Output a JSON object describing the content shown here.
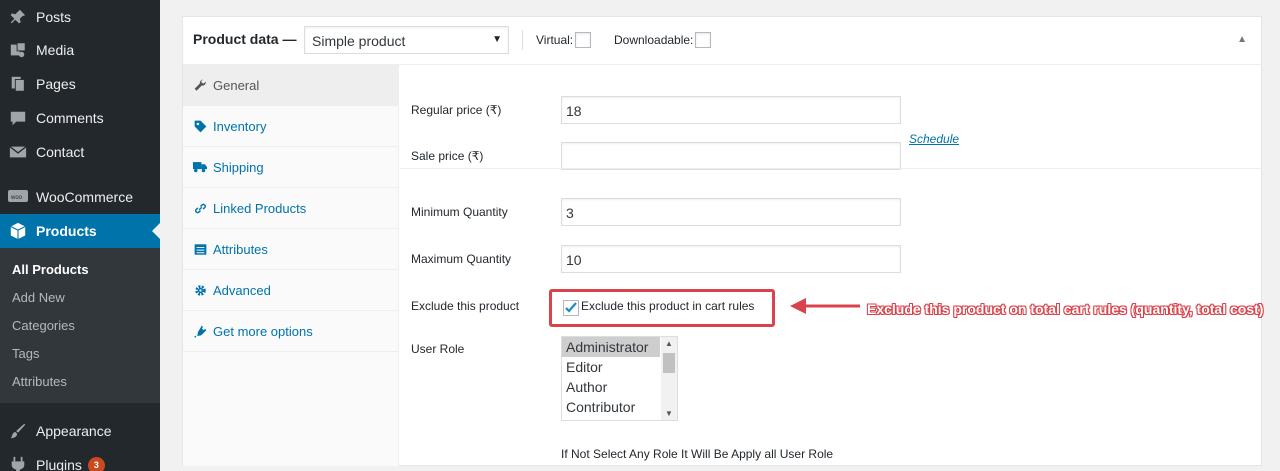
{
  "sidebar": {
    "items": [
      {
        "label": "Posts",
        "icon": "pin-icon"
      },
      {
        "label": "Media",
        "icon": "media-icon"
      },
      {
        "label": "Pages",
        "icon": "pages-icon"
      },
      {
        "label": "Comments",
        "icon": "comments-icon"
      },
      {
        "label": "Contact",
        "icon": "mail-icon"
      },
      {
        "label": "WooCommerce",
        "icon": "woo-icon"
      },
      {
        "label": "Products",
        "icon": "products-icon"
      },
      {
        "label": "Appearance",
        "icon": "brush-icon"
      },
      {
        "label": "Plugins",
        "icon": "plugin-icon",
        "badge": "3"
      }
    ],
    "submenu": [
      "All Products",
      "Add New",
      "Categories",
      "Tags",
      "Attributes"
    ]
  },
  "product_data": {
    "title": "Product data —",
    "type_value": "Simple product",
    "virtual_label": "Virtual:",
    "downloadable_label": "Downloadable:"
  },
  "tabs": [
    "General",
    "Inventory",
    "Shipping",
    "Linked Products",
    "Attributes",
    "Advanced",
    "Get more options"
  ],
  "fields": {
    "regular_price_label": "Regular price (₹)",
    "regular_price_value": "18",
    "sale_price_label": "Sale price (₹)",
    "sale_price_value": "",
    "schedule_link": "Schedule",
    "min_qty_label": "Minimum Quantity",
    "min_qty_value": "3",
    "max_qty_label": "Maximum Quantity",
    "max_qty_value": "10",
    "exclude_label": "Exclude this product",
    "exclude_checkbox_label": "Exclude this product in cart rules",
    "exclude_checked": true,
    "user_role_label": "User Role",
    "roles": [
      "Administrator",
      "Editor",
      "Author",
      "Contributor"
    ],
    "selected_role": "Administrator",
    "hint": "If Not Select Any Role It Will Be Apply all User Role"
  },
  "annotation": {
    "text": "Exclude this product on total cart rules (quantity, total cost)",
    "color": "#d9434b"
  },
  "colors": {
    "accent": "#0073aa",
    "sidebar_bg": "#23282d"
  }
}
